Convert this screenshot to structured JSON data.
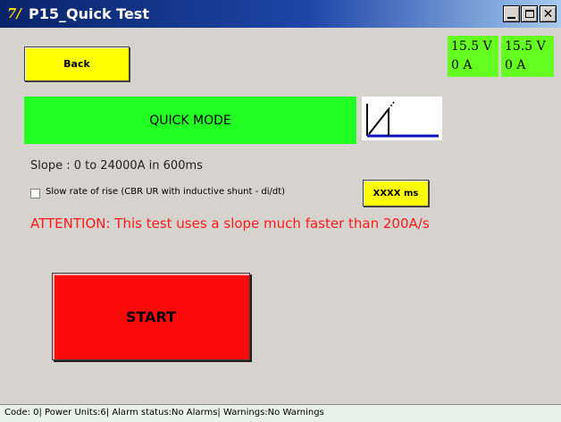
{
  "window": {
    "title": "P15_Quick Test",
    "app_icon_glyph": "7/",
    "controls": [
      "minimize-icon",
      "maximize-icon",
      "close-icon"
    ]
  },
  "toolbar": {
    "back_label": "Back"
  },
  "meters": [
    {
      "voltage": "15.5 V",
      "current": "0 A"
    },
    {
      "voltage": "15.5 V",
      "current": "0 A"
    }
  ],
  "mode": {
    "label": "QUICK MODE",
    "icon": "ramp-slope-icon"
  },
  "test": {
    "slope_text": "Slope : 0 to 24000A in 600ms",
    "slow_rate_label": "Slow rate of rise (CBR UR with inductive shunt - di/dt)",
    "slow_rate_checked": false,
    "duration_button": "XXXX ms",
    "attention_text": "ATTENTION: This test uses a slope much faster than 200A/s",
    "start_label": "START"
  },
  "status": {
    "text": "Code: 0| Power Units:6| Alarm status:No Alarms| Warnings:No Warnings"
  },
  "colors": {
    "titlebar": "#0a246a",
    "back_button": "#ffff00",
    "meter": "#66ff22",
    "mode_bar": "#22ff22",
    "attention": "#ff1a1a",
    "start_button": "#ff0a0a"
  }
}
